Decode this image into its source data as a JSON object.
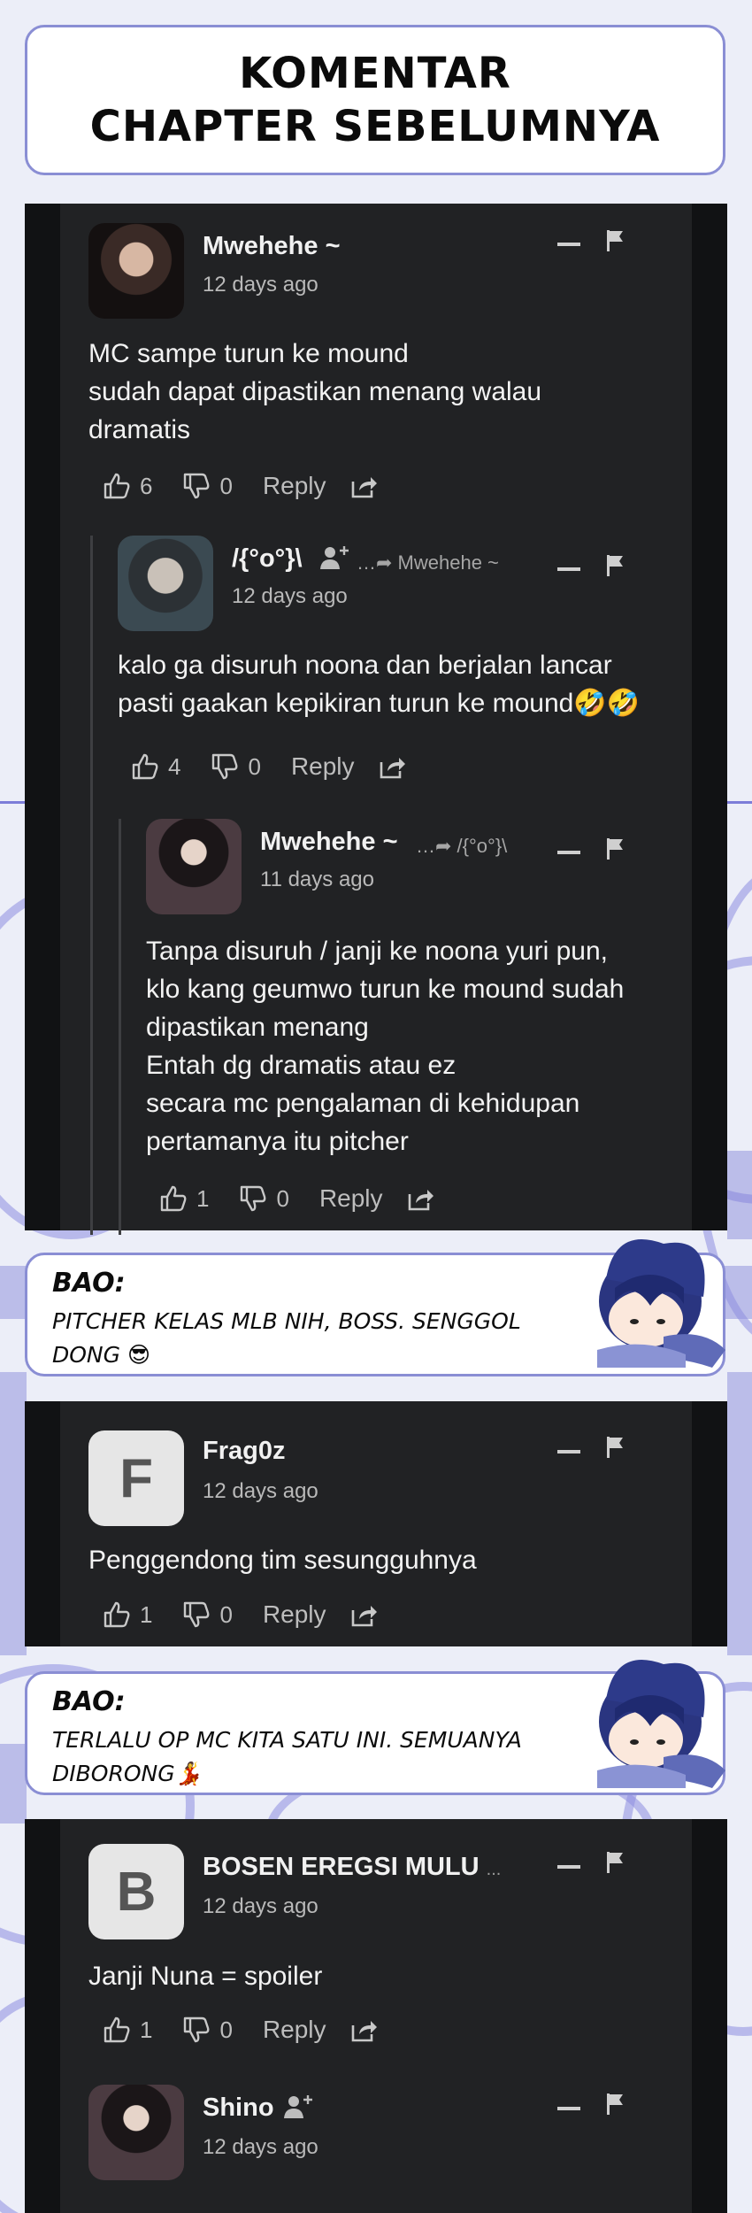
{
  "header": {
    "line1": "Komentar",
    "line2": "Chapter Sebelumnya"
  },
  "comments": {
    "c1": {
      "name": "Mwehehe ~",
      "time": "12 days ago",
      "lines": [
        "MC sampe turun ke mound",
        "sudah dapat dipastikan menang walau",
        "dramatis"
      ],
      "likes": "6",
      "dislikes": "0",
      "reply": "Reply"
    },
    "c2": {
      "name": "/{°o°}\\",
      "reply_to": "Mwehehe ~",
      "time": "12 days ago",
      "lines": [
        "kalo ga disuruh noona dan berjalan lancar",
        "pasti gaakan kepikiran turun ke mound🤣🤣"
      ],
      "likes": "4",
      "dislikes": "0",
      "reply": "Reply"
    },
    "c3": {
      "name": "Mwehehe ~",
      "reply_to": "/{°o°}\\",
      "time": "11 days ago",
      "lines": [
        "Tanpa disuruh / janji ke noona yuri pun,",
        "klo kang geumwo turun ke mound sudah",
        "dipastikan menang",
        "Entah dg dramatis atau ez",
        "secara mc pengalaman di kehidupan",
        "pertamanya itu pitcher"
      ],
      "likes": "1",
      "dislikes": "0",
      "reply": "Reply"
    },
    "c4": {
      "initial": "F",
      "name": "Frag0z",
      "time": "12 days ago",
      "lines": [
        "Penggendong tim sesungguhnya"
      ],
      "likes": "1",
      "dislikes": "0",
      "reply": "Reply"
    },
    "c5": {
      "initial": "B",
      "name": "BOSEN EREGSI MULU",
      "more": "...",
      "time": "12 days ago",
      "lines": [
        "Janji Nuna = spoiler"
      ],
      "likes": "1",
      "dislikes": "0",
      "reply": "Reply"
    },
    "c6": {
      "name": "Shino",
      "time": "12 days ago"
    }
  },
  "bubbles": {
    "b1": {
      "speaker": "Bao:",
      "lines": [
        "Pitcher kelas MLB nih, boss. Senggol",
        "dong 😎"
      ]
    },
    "b2": {
      "speaker": "Bao:",
      "lines": [
        "Terlalu OP MC kita satu ini. Semuanya",
        "diborong💃"
      ]
    }
  },
  "icons": [
    "thumbs-up-icon",
    "thumbs-down-icon",
    "share-icon",
    "flag-icon",
    "minus-icon",
    "add-user-icon",
    "reply-arrow-icon"
  ],
  "colors": {
    "panel": "#212224",
    "accent": "#8a8ed4",
    "text": "#f2f2f2"
  }
}
